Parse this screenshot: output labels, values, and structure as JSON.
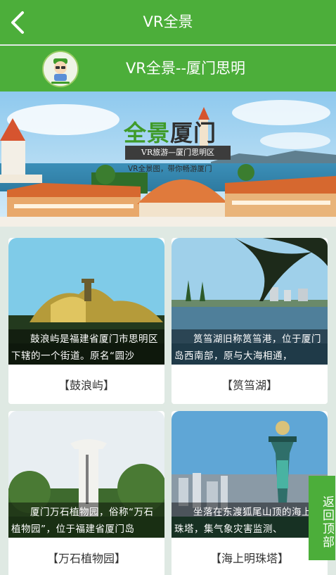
{
  "header": {
    "title": "VR全景"
  },
  "subheader": {
    "title": "VR全景--厦门思明"
  },
  "banner": {
    "title_green": "全景",
    "title_dark": "厦门",
    "subtitle": "VR旅游—厦门思明区",
    "tagline": "VR全景图，带你畅游厦门"
  },
  "spots": [
    {
      "name": "【鼓浪屿】",
      "desc": "鼓浪屿是福建省厦门市思明区下辖的一个街道。原名“圆沙"
    },
    {
      "name": "【筼筜湖】",
      "desc": "筼筜湖旧称筼筜港，位于厦门岛西南部，原与大海相通，"
    },
    {
      "name": "【万石植物园】",
      "desc": "厦门万石植物园，俗称“万石植物园”，位于福建省厦门岛"
    },
    {
      "name": "【海上明珠塔】",
      "desc": "坐落在东渡狐尾山顶的海上明珠塔，集气象灾害监测、"
    }
  ],
  "back_to_top": "返回顶部",
  "colors": {
    "brand_green": "#4cae3a",
    "page_bg": "#dfe9e3"
  },
  "icons": {
    "back": "chevron-left-icon",
    "logo": "mascot-logo-icon"
  }
}
